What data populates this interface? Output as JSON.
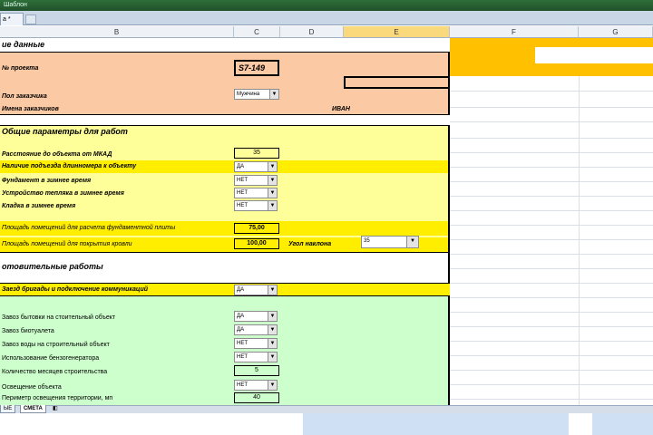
{
  "window": {
    "title": "Шаблон"
  },
  "doc_tab": {
    "label": "а *",
    "new_icon": "new-sheet-icon"
  },
  "columns": [
    "B",
    "C",
    "D",
    "E",
    "F",
    "G"
  ],
  "header_section": {
    "title": "ие данные",
    "project_label": "№ проекта",
    "project_value": "S7-149",
    "gender_label": "Пол заказчика",
    "gender_value": "Мужчина",
    "name_label": "Имена заказчиков",
    "name_value": "ИВАН"
  },
  "params_section": {
    "title": "Общие параметры для работ",
    "distance_label": "Расстояние до объекта от МКАД",
    "distance_value": "35",
    "crane_label": "Наличие подъезда длинномера к объекту",
    "crane_value": "ДА",
    "foundation_label": "Фундамент в зимнее время",
    "foundation_value": "НЕТ",
    "heat_label": "Устройство тепляка в зимнее время",
    "heat_value": "НЕТ",
    "masonry_label": "Кладка в зимнее время",
    "masonry_value": "НЕТ",
    "slab_area_label": "Площадь помещений для расчета фундаментной плиты",
    "slab_area_value": "75,00",
    "roof_area_label": "Площадь помещений для покрытия кровли",
    "roof_area_value": "100,00",
    "slope_label": "Угол наклона",
    "slope_value": "35"
  },
  "prep_section": {
    "title": "отовительные работы",
    "crew_label": "Заезд бригады и подключение коммуникаций",
    "crew_value": "ДА",
    "cabin_label": "Завоз бытовки на стоительный объект",
    "cabin_value": "ДА",
    "toilet_label": "Завоз биотуалета",
    "toilet_value": "ДА",
    "water_label": "Завоз воды на строительный объект",
    "water_value": "НЕТ",
    "generator_label": "Использование бензогенератора",
    "generator_value": "НЕТ",
    "months_label": "Количество месяцев строительства",
    "months_value": "5",
    "lighting_label": "Освещение объекта",
    "lighting_value": "НЕТ",
    "perimeter_label": "Периметр освещения территории, мп",
    "perimeter_value": "40"
  },
  "sheet_tabs": [
    "ЫЕ",
    "СМЕТА"
  ],
  "colors": {
    "peach": "#fbc9a4",
    "yellow": "#ffff99",
    "gold": "#ffee00",
    "green": "#ccffcc",
    "accent": "#ffc000"
  }
}
